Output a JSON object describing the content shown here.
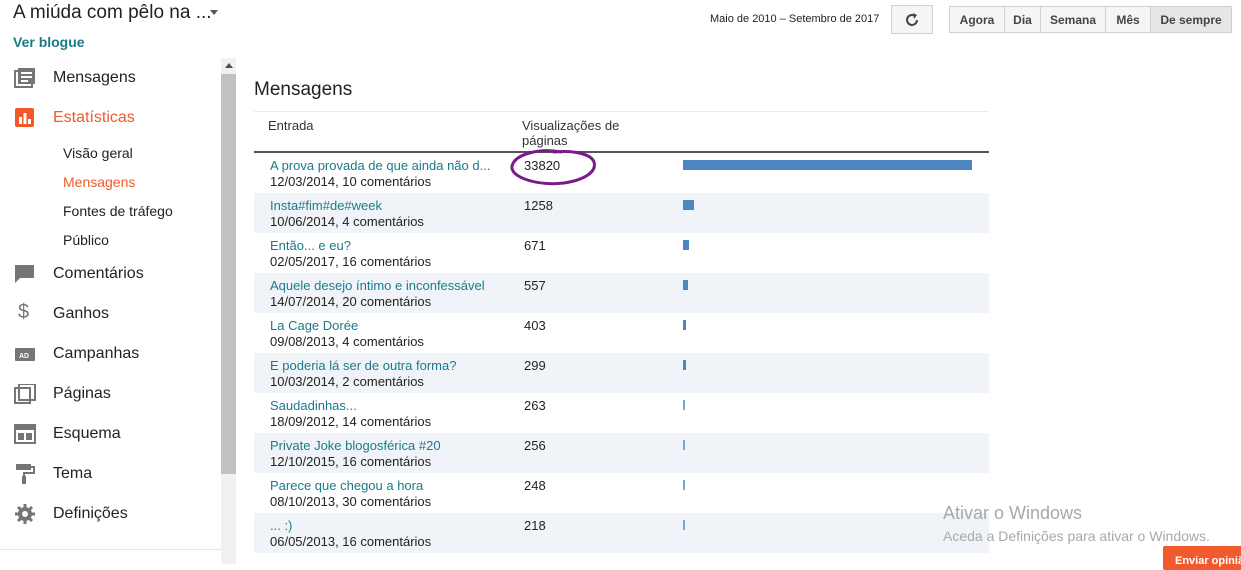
{
  "header": {
    "blog_title": "A miúda com pêlo na ...",
    "view_blog": "Ver blogue"
  },
  "sidebar": {
    "items": [
      {
        "label": "Mensagens",
        "icon": "posts-icon"
      },
      {
        "label": "Estatísticas",
        "icon": "stats-icon"
      },
      {
        "label": "Comentários",
        "icon": "comments-icon"
      },
      {
        "label": "Ganhos",
        "icon": "dollar-icon"
      },
      {
        "label": "Campanhas",
        "icon": "ad-icon"
      },
      {
        "label": "Páginas",
        "icon": "pages-icon"
      },
      {
        "label": "Esquema",
        "icon": "layout-icon"
      },
      {
        "label": "Tema",
        "icon": "paint-roller-icon"
      },
      {
        "label": "Definições",
        "icon": "gear-icon"
      }
    ],
    "subitems": [
      "Visão geral",
      "Mensagens",
      "Fontes de tráfego",
      "Público"
    ],
    "active_item": "Estatísticas",
    "active_subitem": "Mensagens"
  },
  "toolbar": {
    "date_range": "Maio de 2010 – Setembro de 2017",
    "range_buttons": [
      "Agora",
      "Dia",
      "Semana",
      "Mês",
      "De sempre"
    ],
    "selected_range": "De sempre"
  },
  "main": {
    "title": "Mensagens",
    "columns": [
      "Entrada",
      "Visualizações de páginas"
    ],
    "rows": [
      {
        "title": "A prova provada de que ainda não d...",
        "meta": "12/03/2014, 10 comentários",
        "views": 33820
      },
      {
        "title": "Insta#fim#de#week",
        "meta": "10/06/2014, 4 comentários",
        "views": 1258
      },
      {
        "title": "Então... e eu?",
        "meta": "02/05/2017, 16 comentários",
        "views": 671
      },
      {
        "title": "Aquele desejo íntimo e inconfessável",
        "meta": "14/07/2014, 20 comentários",
        "views": 557
      },
      {
        "title": "La Cage Dorée",
        "meta": "09/08/2013, 4 comentários",
        "views": 403
      },
      {
        "title": "E poderia lá ser de outra forma?",
        "meta": "10/03/2014, 2 comentários",
        "views": 299
      },
      {
        "title": "Saudadinhas...",
        "meta": "18/09/2012, 14 comentários",
        "views": 263
      },
      {
        "title": "Private Joke blogosférica #20",
        "meta": "12/10/2015, 16 comentários",
        "views": 256
      },
      {
        "title": "Parece que chegou a hora",
        "meta": "08/10/2013, 30 comentários",
        "views": 248
      },
      {
        "title": "... :)",
        "meta": "06/05/2013, 16 comentários",
        "views": 218
      }
    ]
  },
  "watermark": {
    "line1": "Ativar o Windows",
    "line2": "Aceda a Definições para ativar o Windows."
  },
  "feedback_button": "Enviar opinião",
  "colors": {
    "accent": "#f1592a",
    "link": "#1a7a8a",
    "bar": "#4e86c1",
    "annotation": "#7a1a8a"
  }
}
